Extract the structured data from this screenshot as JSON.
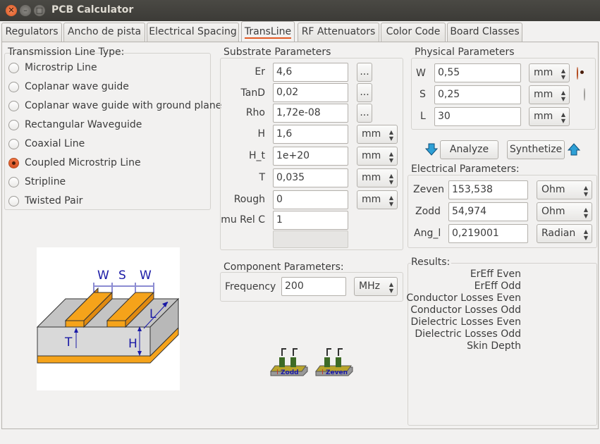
{
  "window": {
    "title": "PCB Calculator"
  },
  "tabs": [
    {
      "label": "Regulators"
    },
    {
      "label": "Ancho de pista"
    },
    {
      "label": "Electrical Spacing"
    },
    {
      "label": "TransLine"
    },
    {
      "label": "RF Attenuators"
    },
    {
      "label": "Color Code"
    },
    {
      "label": "Board Classes"
    }
  ],
  "line_type": {
    "title": "Transmission Line Type:",
    "options": [
      {
        "label": "Microstrip Line",
        "checked": false
      },
      {
        "label": "Coplanar wave guide",
        "checked": false
      },
      {
        "label": "Coplanar wave guide with ground plane",
        "checked": false
      },
      {
        "label": "Rectangular Waveguide",
        "checked": false
      },
      {
        "label": "Coaxial Line",
        "checked": false
      },
      {
        "label": "Coupled Microstrip Line",
        "checked": true
      },
      {
        "label": "Stripline",
        "checked": false
      },
      {
        "label": "Twisted Pair",
        "checked": false
      }
    ]
  },
  "diagram": {
    "w1": "W",
    "s": "S",
    "w2": "W",
    "l": "L",
    "t": "T",
    "h": "H"
  },
  "substrate": {
    "title": "Substrate Parameters",
    "er": {
      "label": "Er",
      "value": "4,6",
      "button": "..."
    },
    "tand": {
      "label": "TanD",
      "value": "0,02",
      "button": "..."
    },
    "rho": {
      "label": "Rho",
      "value": "1,72e-08",
      "button": "..."
    },
    "h": {
      "label": "H",
      "value": "1,6",
      "unit": "mm"
    },
    "h_t": {
      "label": "H_t",
      "value": "1e+20",
      "unit": "mm"
    },
    "t": {
      "label": "T",
      "value": "0,035",
      "unit": "mm"
    },
    "rough": {
      "label": "Rough",
      "value": "0",
      "unit": "mm"
    },
    "murelc": {
      "label": "mu Rel C",
      "value": "1"
    }
  },
  "component": {
    "title": "Component Parameters:",
    "frequency": {
      "label": "Frequency",
      "value": "200",
      "unit": "MHz"
    }
  },
  "mode_icons": {
    "zodd": "Zodd",
    "zeven": "Zeven"
  },
  "physical": {
    "title": "Physical Parameters",
    "w": {
      "label": "W",
      "value": "0,55",
      "unit": "mm",
      "selected": true
    },
    "s": {
      "label": "S",
      "value": "0,25",
      "unit": "mm",
      "selected": false
    },
    "l": {
      "label": "L",
      "value": "30",
      "unit": "mm"
    }
  },
  "actions": {
    "analyze": "Analyze",
    "synthetize": "Synthetize"
  },
  "electrical": {
    "title": "Electrical Parameters:",
    "zeven": {
      "label": "Zeven",
      "value": "153,538",
      "unit": "Ohm"
    },
    "zodd": {
      "label": "Zodd",
      "value": "54,974",
      "unit": "Ohm"
    },
    "ang_l": {
      "label": "Ang_l",
      "value": "0,219001",
      "unit": "Radian"
    }
  },
  "results": {
    "title": "Results:",
    "items": [
      "ErEff Even",
      "ErEff Odd",
      "Conductor Losses Even",
      "Conductor Losses Odd",
      "Dielectric Losses Even",
      "Dielectric Losses Odd",
      "Skin Depth"
    ]
  },
  "colors": {
    "accent": "#e35b24",
    "titlebar": "#3c3b37",
    "window_bg": "#f2f1f0"
  }
}
